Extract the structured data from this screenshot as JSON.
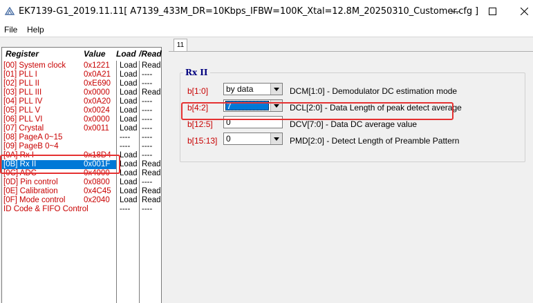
{
  "window": {
    "title": "EK7139-G1_2019.11.11[ A7139_433M_DR=10Kbps_IFBW=100K_Xtal=12.8M_20250310_Customer.cfg ]"
  },
  "menu": {
    "file": "File",
    "help": "Help"
  },
  "register_list": {
    "headers": {
      "register": "Register",
      "value": "Value",
      "load": "Load",
      "read": "/Read"
    },
    "rows": [
      {
        "register": "[00] System clock",
        "value": "0x1221",
        "load": "Load",
        "read": "Read"
      },
      {
        "register": "[01] PLL I",
        "value": "0x0A21",
        "load": "Load",
        "read": "----"
      },
      {
        "register": "[02] PLL II",
        "value": "0xE690",
        "load": "Load",
        "read": "----"
      },
      {
        "register": "[03] PLL III",
        "value": "0x0000",
        "load": "Load",
        "read": "Read"
      },
      {
        "register": "[04] PLL IV",
        "value": "0x0A20",
        "load": "Load",
        "read": "----"
      },
      {
        "register": "[05] PLL V",
        "value": "0x0024",
        "load": "Load",
        "read": "----"
      },
      {
        "register": "[06] PLL VI",
        "value": "0x0000",
        "load": "Load",
        "read": "----"
      },
      {
        "register": "[07] Crystal",
        "value": "0x0011",
        "load": "Load",
        "read": "----"
      },
      {
        "register": "[08] PageA 0~15",
        "value": "",
        "load": "----",
        "read": "----"
      },
      {
        "register": "[09] PageB 0~4",
        "value": "",
        "load": "----",
        "read": "----"
      },
      {
        "register": "[0A] Rx I",
        "value": "0x18D4",
        "load": "Load",
        "read": "----"
      },
      {
        "register": "[0B] Rx II",
        "value": "0x001F",
        "load": "Load",
        "read": "Read",
        "selected": true
      },
      {
        "register": "[0C] ADC",
        "value": "0x4000",
        "load": "Load",
        "read": "Read"
      },
      {
        "register": "[0D] Pin control",
        "value": "0x0800",
        "load": "Load",
        "read": "----"
      },
      {
        "register": "[0E] Calibration",
        "value": "0x4C45",
        "load": "Load",
        "read": "Read"
      },
      {
        "register": "[0F] Mode control",
        "value": "0x2040",
        "load": "Load",
        "read": "Read"
      },
      {
        "register": "ID Code & FIFO Control",
        "value": "",
        "load": "----",
        "read": "----"
      }
    ]
  },
  "tab": {
    "label": "11"
  },
  "rx2": {
    "title": "Rx II",
    "fields": [
      {
        "bits": "b[1:0]",
        "control": "combo",
        "value": "by data",
        "description": "DCM[1:0] - Demodulator DC estimation mode"
      },
      {
        "bits": "b[4:2]",
        "control": "combo",
        "value": "7",
        "description": "DCL[2:0] - Data Length of peak detect average",
        "focused": true
      },
      {
        "bits": "b[12:5]",
        "control": "input",
        "value": "0",
        "description": "DCV[7:0] - Data DC average value"
      },
      {
        "bits": "b[15:13]",
        "control": "combo",
        "value": "0",
        "description": "PMD[2:0] - Detect Length of Preamble Pattern"
      }
    ]
  },
  "colors": {
    "register_text": "#c80000",
    "selection": "#0078d7",
    "group_title": "#00007f",
    "highlight": "#e53030"
  },
  "icons": [
    "app-icon",
    "minimize-icon",
    "maximize-icon",
    "close-icon",
    "dropdown-arrow-icon"
  ]
}
